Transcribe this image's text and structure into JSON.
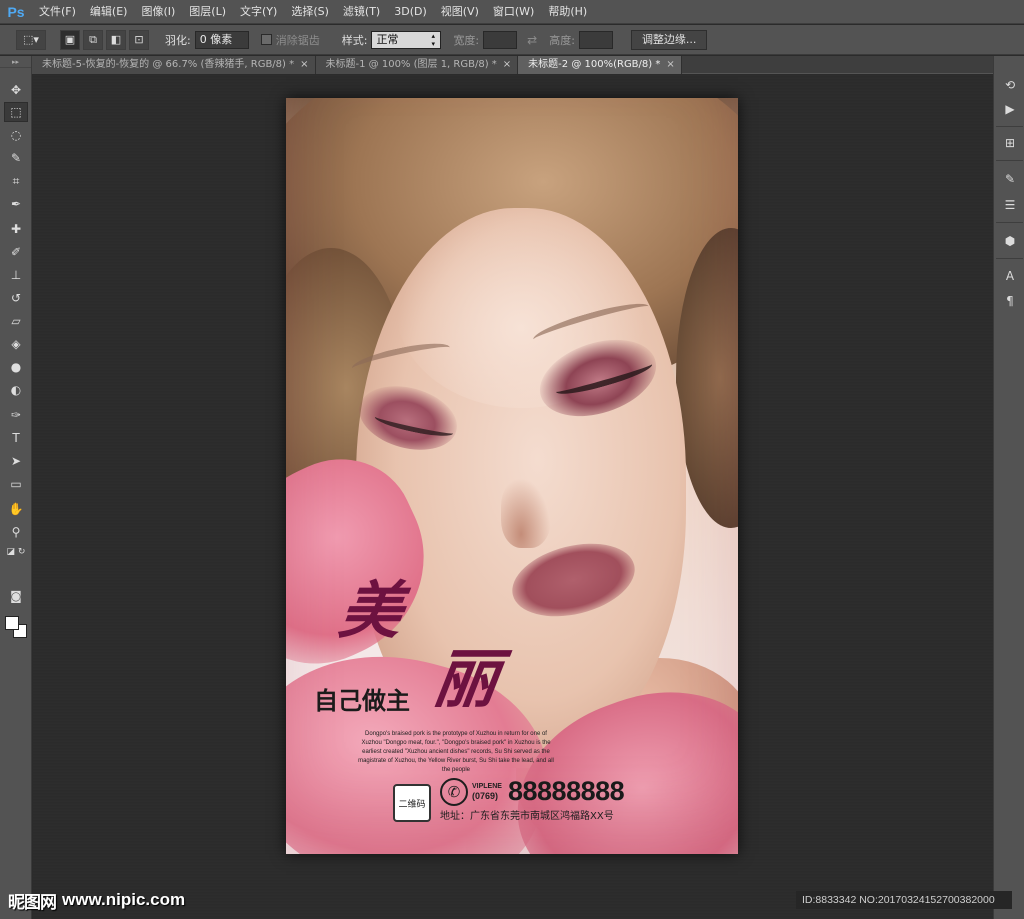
{
  "app": {
    "logo": "Ps",
    "menu": [
      "文件(F)",
      "编辑(E)",
      "图像(I)",
      "图层(L)",
      "文字(Y)",
      "选择(S)",
      "滤镜(T)",
      "3D(D)",
      "视图(V)",
      "窗口(W)",
      "帮助(H)"
    ]
  },
  "options": {
    "feather_label": "羽化:",
    "feather_value": "0 像素",
    "antialias_label": "消除锯齿",
    "style_label": "样式:",
    "style_value": "正常",
    "width_label": "宽度:",
    "height_label": "高度:",
    "refine_edge_button": "调整边缘..."
  },
  "tabs": [
    {
      "title": "未标题-5-恢复的-恢复的 @ 66.7% (香辣猪手, RGB/8) *",
      "close": "×",
      "active": false
    },
    {
      "title": "未标题-1 @ 100% (图层 1, RGB/8) *",
      "close": "×",
      "active": false
    },
    {
      "title": "未标题-2 @ 100%(RGB/8) *",
      "close": "×",
      "active": true
    }
  ],
  "tools": [
    "move-tool",
    "rectangular-marquee-tool",
    "lasso-tool",
    "quick-selection-tool",
    "crop-tool",
    "eyedropper-tool",
    "spot-healing-tool",
    "brush-tool",
    "clone-stamp-tool",
    "history-brush-tool",
    "eraser-tool",
    "paint-bucket-tool",
    "blur-tool",
    "dodge-tool",
    "pen-tool",
    "type-tool",
    "path-selection-tool",
    "rectangle-shape-tool",
    "hand-tool",
    "zoom-tool"
  ],
  "poster": {
    "title_char_1": "美",
    "title_char_2": "丽",
    "subtitle": "自己做主",
    "body": "Dongpo's braised pork is the prototype of Xuzhou in return for one of Xuzhou \"Dongpo meat, four.\", \"Dongpo's braised pork\" in Xuzhou is the earliest created \"Xuzhou ancient dishes\" records, Su Shi served as the magistrate of Xuzhou, the Yellow River burst, Su Shi take the lead, and all the people",
    "qr_label": "二维码",
    "brand": "VIPLENE",
    "area_code": "(0769)",
    "phone": "88888888",
    "address": "地址：广东省东莞市南城区鸿福路XX号"
  },
  "watermark": {
    "logo_text": "昵图网",
    "url": "www.nipic.com",
    "id_text": "ID:8833342 NO:20170324152700382000"
  },
  "colors": {
    "accent_blue": "#4fa9f3",
    "title_wine": "#6d1240",
    "workspace_bg": "#2b2b2b",
    "panel_bg": "#535353"
  }
}
